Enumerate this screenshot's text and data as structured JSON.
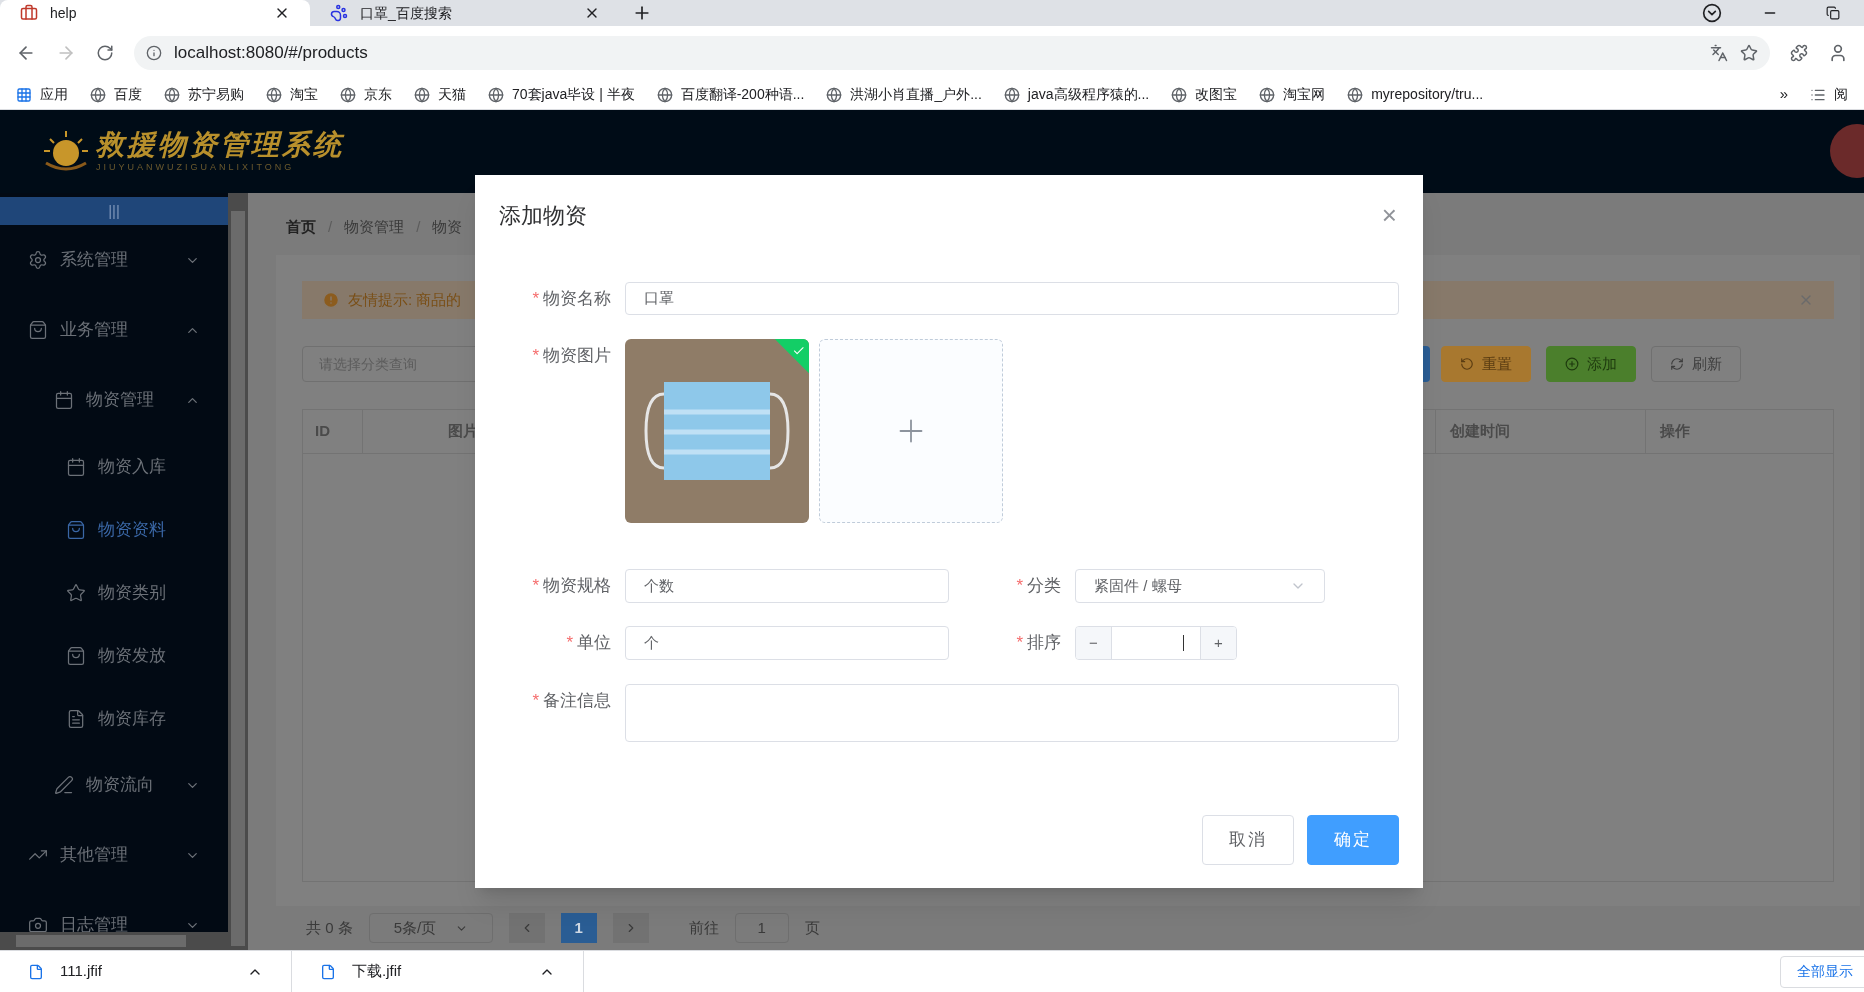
{
  "browser": {
    "tabs": [
      {
        "title": "help",
        "selected": true
      },
      {
        "title": "口罩_百度搜索",
        "selected": false
      }
    ],
    "url": "localhost:8080/#/products",
    "bookmarks": [
      "应用",
      "百度",
      "苏宁易购",
      "淘宝",
      "京东",
      "天猫",
      "70套java毕设 | 半夜",
      "百度翻译-200种语...",
      "洪湖小肖直播_户外...",
      "java高级程序猿的...",
      "改图宝",
      "淘宝网",
      "myrepository/tru..."
    ],
    "bookmarks_more": "»",
    "reading_list": "阅"
  },
  "header": {
    "logo_title": "救援物资管理系统",
    "logo_subtitle": "JIUYUANWUZIGUANLIXITONG"
  },
  "sidebar": {
    "toggle": "|||",
    "items": [
      {
        "label": "系统管理",
        "expanded": false,
        "selected": false
      },
      {
        "label": "业务管理",
        "expanded": true,
        "selected": false,
        "children": [
          {
            "label": "物资管理",
            "expanded": true,
            "selected": false,
            "children": [
              {
                "label": "物资入库",
                "selected": false
              },
              {
                "label": "物资资料",
                "selected": true
              },
              {
                "label": "物资类别",
                "selected": false
              },
              {
                "label": "物资发放",
                "selected": false
              },
              {
                "label": "物资库存",
                "selected": false
              }
            ]
          },
          {
            "label": "物资流向",
            "expanded": false,
            "selected": false
          }
        ]
      },
      {
        "label": "其他管理",
        "expanded": false,
        "selected": false
      },
      {
        "label": "日志管理",
        "expanded": false,
        "selected": false
      }
    ]
  },
  "breadcrumb": [
    {
      "label": "首页"
    },
    {
      "separator": "/",
      "label": "物资管理"
    },
    {
      "separator": "/",
      "label": "物资"
    }
  ],
  "alert": {
    "text": "友情提示: 商品的"
  },
  "filter": {
    "placeholder": "请选择分类查询"
  },
  "toolbar": [
    {
      "label": "重置",
      "kind": "reset"
    },
    {
      "label": "添加",
      "kind": "add"
    },
    {
      "label": "刷新",
      "kind": "refresh"
    }
  ],
  "table": {
    "columns": [
      "ID",
      "图片",
      "创建时间",
      "操作"
    ]
  },
  "pagination": {
    "total": "共 0 条",
    "page_size": "5条/页",
    "pages": [
      {
        "label": "1",
        "selected": true
      }
    ],
    "goto_label": "前往",
    "goto_value": "1",
    "goto_suffix": "页"
  },
  "dialog": {
    "title": "添加物资",
    "close": "×",
    "name": {
      "label": "物资名称",
      "required_mark": "*",
      "value": "口罩"
    },
    "image": {
      "label": "物资图片",
      "required_mark": "*",
      "uploaded": true
    },
    "spec": {
      "label": "物资规格",
      "required_mark": "*",
      "value": "个数"
    },
    "category": {
      "label": "分类",
      "required_mark": "*",
      "value": "紧固件 / 螺母"
    },
    "unit": {
      "label": "单位",
      "required_mark": "*",
      "value": "个"
    },
    "order": {
      "label": "排序",
      "required_mark": "*",
      "minus": "−",
      "plus": "+"
    },
    "remark": {
      "label": "备注信息",
      "required_mark": "*"
    },
    "buttons": [
      {
        "label": "取消",
        "kind": "secondary"
      },
      {
        "label": "确定",
        "kind": "primary"
      }
    ]
  },
  "downloads": {
    "files": [
      "111.jfif",
      "下载.jfif"
    ],
    "show_all": "全部显示"
  }
}
